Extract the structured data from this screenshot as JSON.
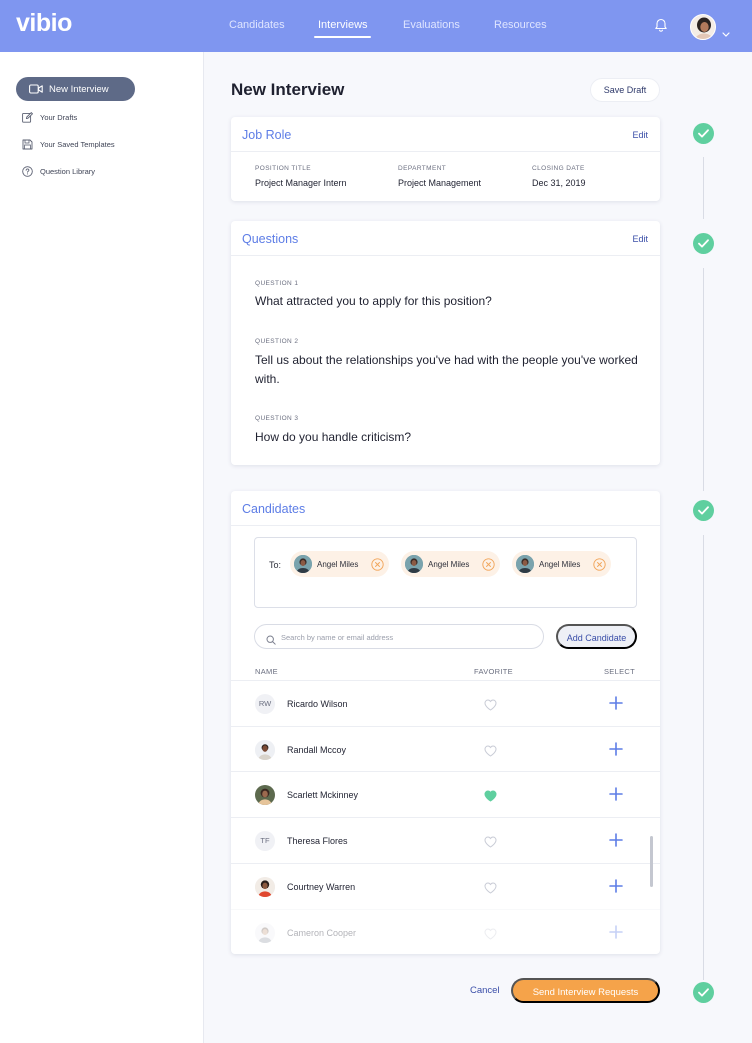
{
  "brand": {
    "logo": "vibio",
    "accent": "#7f96f0",
    "success": "#5fcf9f",
    "primary_action": "#f5a34a"
  },
  "nav": {
    "links": [
      "Candidates",
      "Interviews",
      "Evaluations",
      "Resources"
    ],
    "active": "Interviews",
    "notification_icon": "bell-icon",
    "user_menu_icon": "chevron-down-icon"
  },
  "sidebar": {
    "new_interview": "New Interview",
    "items": [
      {
        "label": "Your Drafts",
        "icon": "edit-icon"
      },
      {
        "label": "Your Saved Templates",
        "icon": "save-icon"
      },
      {
        "label": "Question Library",
        "icon": "help-icon"
      }
    ]
  },
  "page": {
    "title": "New Interview",
    "save_draft": "Save Draft"
  },
  "job_role": {
    "title": "Job Role",
    "edit": "Edit",
    "fields": [
      {
        "label": "POSITION TITLE",
        "value": "Project Manager Intern"
      },
      {
        "label": "DEPARTMENT",
        "value": "Project Management"
      },
      {
        "label": "CLOSING DATE",
        "value": "Dec 31, 2019"
      }
    ]
  },
  "questions": {
    "title": "Questions",
    "edit": "Edit",
    "items": [
      {
        "label": "QUESTION 1",
        "text": "What attracted you to apply for this position?"
      },
      {
        "label": "QUESTION 2",
        "text": "Tell us about the relationships you've had with the people you've worked with."
      },
      {
        "label": "QUESTION 3",
        "text": "How do you handle criticism?"
      }
    ]
  },
  "candidates": {
    "title": "Candidates",
    "to_label": "To:",
    "recipients": [
      "Angel Miles",
      "Angel Miles",
      "Angel Miles"
    ],
    "search_placeholder": "Search by name or email address",
    "add_button": "Add Candidate",
    "columns": [
      "NAME",
      "FAVORITE",
      "SELECT"
    ],
    "rows": [
      {
        "initials": "RW",
        "name": "Ricardo Wilson",
        "favorite": false
      },
      {
        "initials": "",
        "name": "Randall Mccoy",
        "favorite": false
      },
      {
        "initials": "",
        "name": "Scarlett Mckinney",
        "favorite": true
      },
      {
        "initials": "TF",
        "name": "Theresa Flores",
        "favorite": false
      },
      {
        "initials": "",
        "name": "Courtney Warren",
        "favorite": false
      },
      {
        "initials": "",
        "name": "Cameron Cooper",
        "favorite": false
      }
    ]
  },
  "footer": {
    "cancel": "Cancel",
    "send": "Send Interview Requests"
  }
}
